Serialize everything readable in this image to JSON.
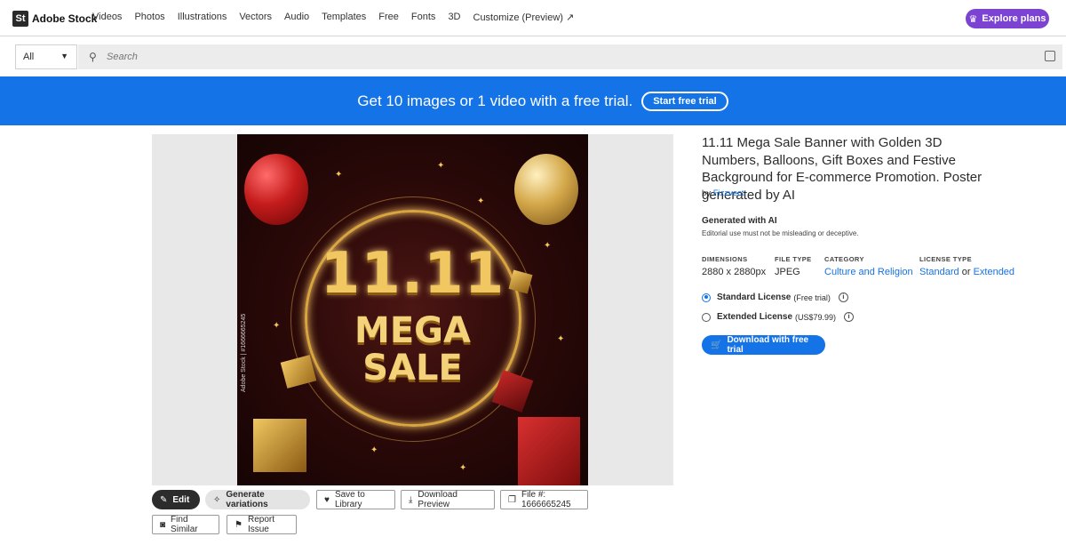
{
  "topnav": {
    "logo_mark": "St",
    "logo_text": "Adobe Stock",
    "links": [
      "Videos",
      "Photos",
      "Illustrations",
      "Vectors",
      "Audio",
      "Templates",
      "Free",
      "Fonts",
      "3D",
      "Customize (Preview) ↗"
    ],
    "explore_label": "Explore plans"
  },
  "search": {
    "filter_value": "All",
    "placeholder": "Search"
  },
  "banner": {
    "text": "Get 10 images or 1 video with a free trial.",
    "button_label": "Start free trial"
  },
  "poster": {
    "line1": "11.11",
    "line2": "MEGA",
    "line3": "SALE",
    "watermark": "Adobe Stock | #1666665245"
  },
  "actions": {
    "edit": "Edit",
    "generate": "Generate variations",
    "save": "Save to Library",
    "download_preview": "Download Preview",
    "file": "File #: 1666665245",
    "find_similar": "Find Similar",
    "report": "Report Issue"
  },
  "details": {
    "title": "11.11 Mega Sale Banner with Golden 3D Numbers, Balloons, Gift Boxes and Festive Background for E-commerce Promotion. Poster generated by AI",
    "by_label": "by",
    "author": "Fizzvect",
    "gen_title": "Generated with AI",
    "gen_sub": "Editorial use must not be misleading or deceptive.",
    "meta": {
      "dimensions_label": "DIMENSIONS",
      "dimensions_value": "2880 x 2880px",
      "filetype_label": "FILE TYPE",
      "filetype_value": "JPEG",
      "category_label": "CATEGORY",
      "category_value": "Culture and Religion",
      "license_label": "LICENSE TYPE",
      "license_standard": "Standard",
      "license_or": "or",
      "license_extended": "Extended"
    },
    "licenses": {
      "standard_name": "Standard License",
      "standard_note": "(Free trial)",
      "extended_name": "Extended License",
      "extended_note": "(US$79.99)"
    },
    "download_label": "Download with free trial"
  },
  "colors": {
    "brand_blue": "#1473e6",
    "explore_purple": "#7c43d3"
  }
}
